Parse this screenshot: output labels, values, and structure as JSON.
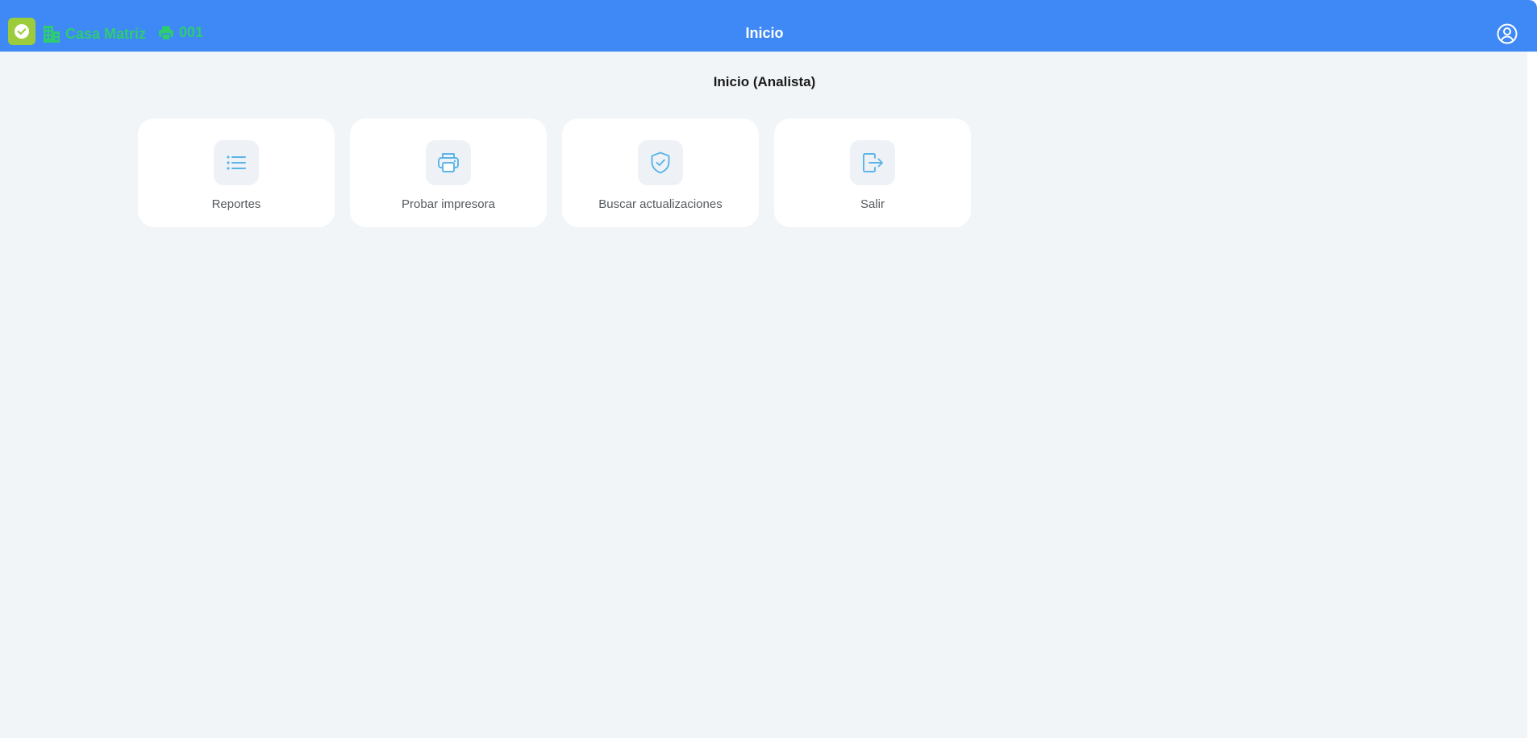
{
  "header": {
    "title": "Inicio",
    "branch": {
      "label": "Casa Matriz",
      "icon": "building-icon"
    },
    "register": {
      "label": "001",
      "icon": "printer-icon"
    },
    "logo_icon": "check-circle-icon",
    "account_icon": "user-circle-icon"
  },
  "main": {
    "title": "Inicio (Analista)",
    "cards": [
      {
        "label": "Reportes",
        "icon": "list-icon"
      },
      {
        "label": "Probar impresora",
        "icon": "printer-icon"
      },
      {
        "label": "Buscar actualizaciones",
        "icon": "shield-check-icon"
      },
      {
        "label": "Salir",
        "icon": "logout-icon"
      }
    ]
  },
  "colors": {
    "header_bg": "#3e89f5",
    "accent_green": "#2ecc71",
    "logo_bg": "#9ccc3c",
    "icon_blue": "#5ab4e8",
    "page_bg": "#f1f5f8"
  }
}
